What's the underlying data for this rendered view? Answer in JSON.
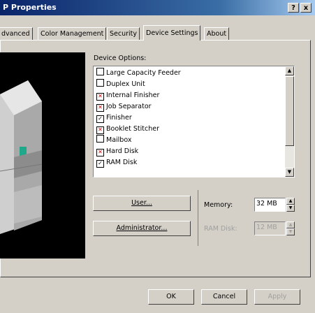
{
  "window": {
    "title": "P Properties",
    "help_btn": "?",
    "close_btn": "x"
  },
  "tabs": [
    {
      "label": "dvanced",
      "active": false
    },
    {
      "label": "Color Management",
      "active": false
    },
    {
      "label": "Security",
      "active": false
    },
    {
      "label": "Device Settings",
      "active": true
    },
    {
      "label": "About",
      "active": false
    }
  ],
  "device_options": {
    "label": "Device Options:",
    "items": [
      {
        "label": "Large Capacity Feeder",
        "state": "unchecked"
      },
      {
        "label": "Duplex Unit",
        "state": "unchecked"
      },
      {
        "label": "Internal Finisher",
        "state": "x"
      },
      {
        "label": "Job Separator",
        "state": "x"
      },
      {
        "label": "Finisher",
        "state": "checked"
      },
      {
        "label": "Booklet Stitcher",
        "state": "x"
      },
      {
        "label": "Mailbox",
        "state": "unchecked"
      },
      {
        "label": "Hard Disk",
        "state": "x"
      },
      {
        "label": "RAM Disk",
        "state": "checked"
      }
    ]
  },
  "buttons": {
    "user": "User...",
    "administrator": "Administrator..."
  },
  "memory": {
    "label": "Memory:",
    "value": "32 MB"
  },
  "ram_disk": {
    "label": "RAM Disk:",
    "value": "12 MB"
  },
  "footer": {
    "ok": "OK",
    "cancel": "Cancel",
    "apply": "Apply"
  }
}
